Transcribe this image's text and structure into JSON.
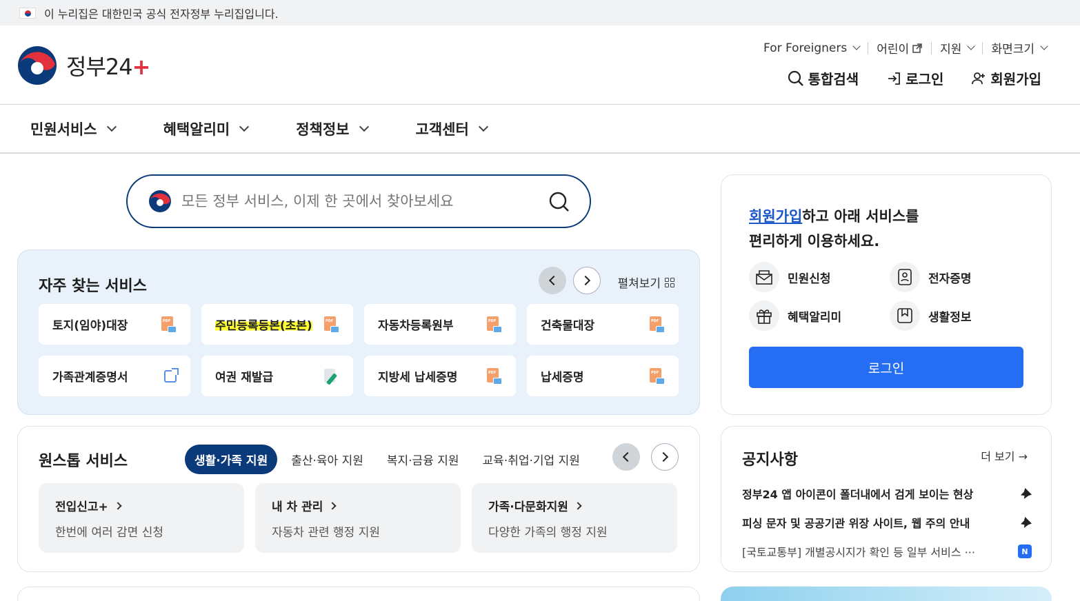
{
  "topbar": {
    "notice": "이 누리집은 대한민국 공식 전자정부 누리집입니다."
  },
  "logo": {
    "name": "정부24",
    "prefix": "정부2",
    "digit": "4",
    "plus": "+"
  },
  "util": [
    {
      "label": "For Foreigners"
    },
    {
      "label": "어린이"
    },
    {
      "label": "지원"
    },
    {
      "label": "화면크기"
    }
  ],
  "actions": {
    "search": "통합검색",
    "login": "로그인",
    "signup": "회원가입"
  },
  "nav": [
    "민원서비스",
    "혜택알리미",
    "정책정보",
    "고객센터"
  ],
  "search": {
    "placeholder": "모든 정부 서비스, 이제 한 곳에서 찾아보세요"
  },
  "frequent": {
    "title": "자주 찾는 서비스",
    "expand_label": "펼쳐보기",
    "tiles": [
      {
        "label": "토지(임야)대장",
        "icon": "pdf-icon"
      },
      {
        "label": "주민등록등본(초본)",
        "icon": "pdf-icon",
        "highlighted": true
      },
      {
        "label": "자동차등록원부",
        "icon": "pdf-icon"
      },
      {
        "label": "건축물대장",
        "icon": "pdf-icon"
      },
      {
        "label": "가족관계증명서",
        "icon": "external-link-icon"
      },
      {
        "label": "여권 재발급",
        "icon": "edit-icon"
      },
      {
        "label": "지방세 납세증명",
        "icon": "pdf-icon"
      },
      {
        "label": "납세증명",
        "icon": "pdf-icon"
      }
    ]
  },
  "onestop": {
    "title": "원스톱 서비스",
    "tabs": [
      "생활·가족 지원",
      "출산·육아 지원",
      "복지·금융 지원",
      "교육·취업·기업 지원"
    ],
    "active_tab": 0,
    "cards": [
      {
        "title": "전입신고+",
        "desc": "한번에 여러 감면 신청"
      },
      {
        "title": "내 차 관리",
        "desc": "자동차 관련 행정 지원"
      },
      {
        "title": "가족·다문화지원",
        "desc": "다양한 가족의 행정 지원"
      }
    ]
  },
  "side_login": {
    "link": "회원가입",
    "msg_rest": "하고 아래 서비스를",
    "msg_line2": "편리하게 이용하세요.",
    "items": [
      {
        "label": "민원신청",
        "icon": "mail-icon"
      },
      {
        "label": "전자증명",
        "icon": "id-card-icon"
      },
      {
        "label": "혜택알리미",
        "icon": "gift-icon"
      },
      {
        "label": "생활정보",
        "icon": "bookmark-icon"
      }
    ],
    "button": "로그인"
  },
  "notice": {
    "title": "공지사항",
    "more": "더 보기",
    "items": [
      {
        "text": "정부24 앱 아이콘이 폴더내에서 검게 보이는 현상",
        "badge": "pin-icon"
      },
      {
        "text": "피싱 문자 및 공공기관 위장 사이트, 웹 주의 안내",
        "badge": "pin-icon"
      },
      {
        "text": "[국토교통부] 개별공시지가 확인 등 일부 서비스 ···",
        "badge": "N"
      }
    ]
  },
  "colors": {
    "primary": "#0b3a7a",
    "accent_button": "#256ef4",
    "highlight": "#ffff33",
    "frequent_bg": "#e9f2fb"
  }
}
